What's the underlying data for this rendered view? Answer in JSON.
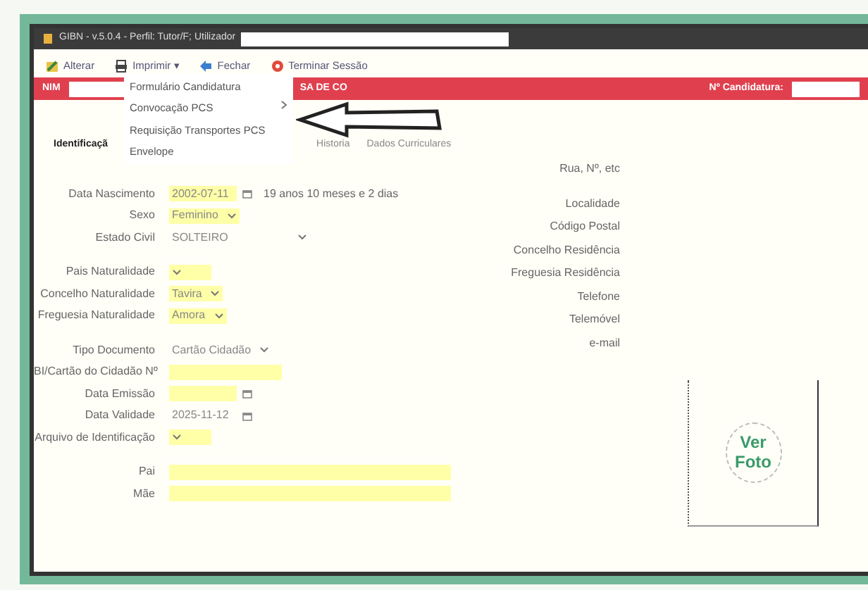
{
  "window": {
    "title": "GIBN - v.5.0.4 - Perfil: Tutor/F; Utilizador"
  },
  "toolbar": [
    {
      "label": "Alterar",
      "kind": "edit"
    },
    {
      "label": "Imprimir",
      "kind": "print",
      "caret": "▾"
    },
    {
      "label": "Fechar",
      "kind": "back"
    },
    {
      "label": "Terminar Sessão",
      "kind": "power"
    }
  ],
  "header_bar": {
    "left_label": "NIM",
    "center_text": "SA DE CO",
    "right_label": "Nº Candidatura:"
  },
  "tabs": [
    {
      "label": "Identificaçã",
      "selected": true
    },
    {
      "label": "Historia",
      "selected": false
    },
    {
      "label": "Dados Curriculares",
      "selected": false
    }
  ],
  "print_menu": [
    {
      "label": "Formulário Candidatura",
      "submenu": false
    },
    {
      "label": "Convocação PCS",
      "submenu": true
    },
    {
      "label": "Requisição Transportes PCS",
      "submenu": false
    },
    {
      "label": "Envelope",
      "submenu": false
    }
  ],
  "left_groups": [
    [
      {
        "label": "Data Nascimento",
        "kind": "date",
        "value": "2002-07-11",
        "highlighted": true,
        "note": "19 anos 10 meses e 2 dias"
      },
      {
        "label": "Sexo",
        "kind": "select",
        "value": "Feminino",
        "highlighted": true
      },
      {
        "label": "Estado Civil",
        "kind": "wideselect",
        "value": "SOLTEIRO",
        "highlighted": false
      }
    ],
    [
      {
        "label": "Pais Naturalidade",
        "kind": "select",
        "highlighted": true
      },
      {
        "label": "Concelho Naturalidade",
        "kind": "select",
        "value": "Tavira",
        "highlighted": true
      },
      {
        "label": "Freguesia Naturalidade",
        "kind": "select",
        "value": "Amora",
        "highlighted": true
      }
    ],
    [
      {
        "label": "Tipo Documento",
        "kind": "select",
        "value": "Cartão Cidadão",
        "highlighted": false
      },
      {
        "label": "BI/Cartão do Cidadão Nº",
        "kind": "text",
        "highlighted": true
      },
      {
        "label": "Data Emissão",
        "kind": "date",
        "highlighted": true
      },
      {
        "label": "Data Validade",
        "kind": "date",
        "value": "2025-11-12",
        "highlighted": false
      },
      {
        "label": "Arquivo de Identificação",
        "kind": "select",
        "highlighted": true
      }
    ],
    [
      {
        "label": "Pai",
        "kind": "widetext",
        "highlighted": true
      },
      {
        "label": "Mãe",
        "kind": "widetext",
        "highlighted": true
      }
    ]
  ],
  "right_fields": [
    {
      "label": "Rua, Nº, etc"
    },
    {
      "label": "Localidade"
    },
    {
      "label": "Código Postal"
    },
    {
      "label": "Concelho Residência"
    },
    {
      "label": "Freguesia Residência"
    },
    {
      "label": "Telefone"
    },
    {
      "label": "Telemóvel"
    },
    {
      "label": "e-mail"
    }
  ],
  "photo": {
    "link": "Ver Foto"
  }
}
